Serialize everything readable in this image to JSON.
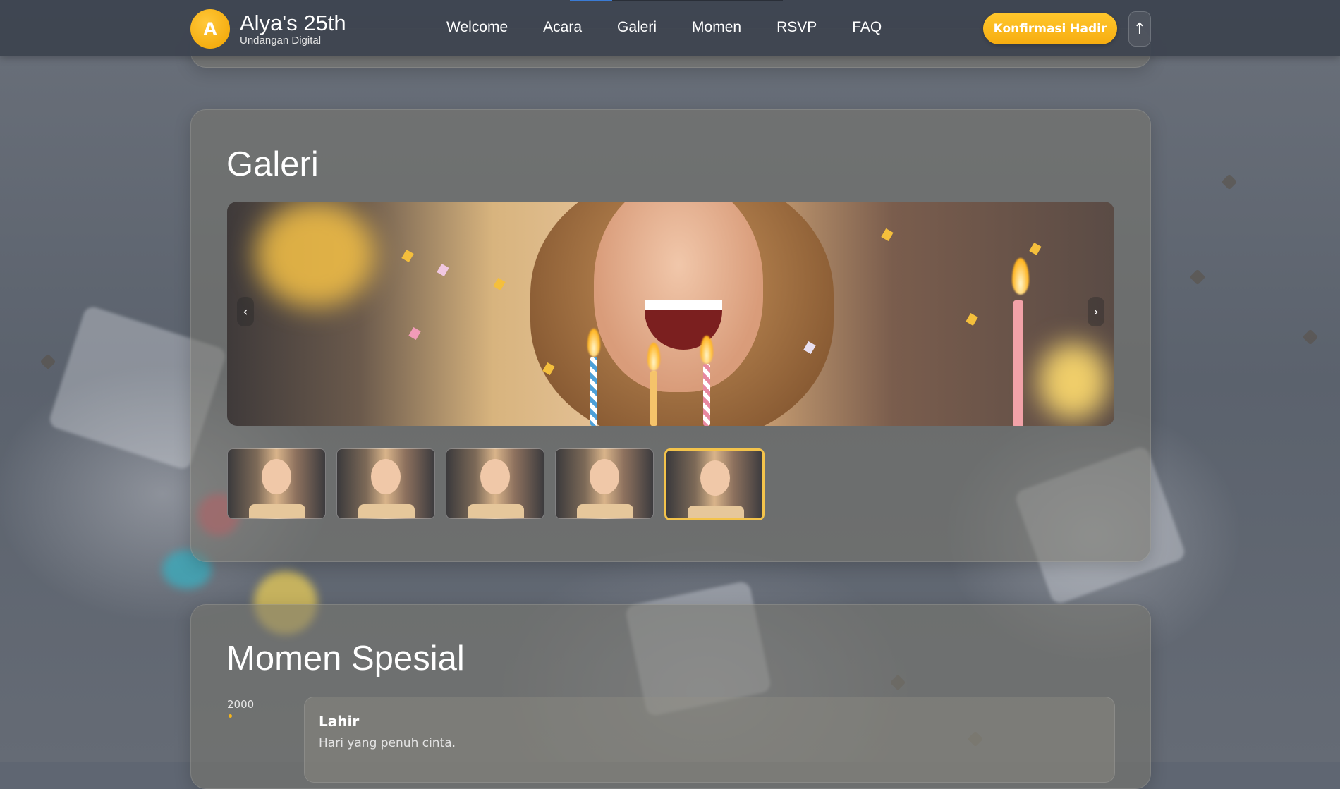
{
  "header": {
    "avatar_letter": "A",
    "title": "Alya's 25th",
    "subtitle": "Undangan Digital",
    "nav": [
      "Welcome",
      "Acara",
      "Galeri",
      "Momen",
      "RSVP",
      "FAQ"
    ],
    "cta_label": "Konfirmasi Hadir",
    "scroll_top_icon": "↑"
  },
  "gallery": {
    "title": "Galeri",
    "prev_icon": "‹",
    "next_icon": "›",
    "thumbnail_count": 5,
    "active_thumbnail": 5
  },
  "moments": {
    "title": "Momen Spesial",
    "items": [
      {
        "year": "2000",
        "title": "Lahir",
        "description": "Hari yang penuh cinta."
      }
    ]
  },
  "colors": {
    "accent": "#f7ad10",
    "header_bg": "#3c424e",
    "active_thumb_border": "#f3c34b"
  }
}
